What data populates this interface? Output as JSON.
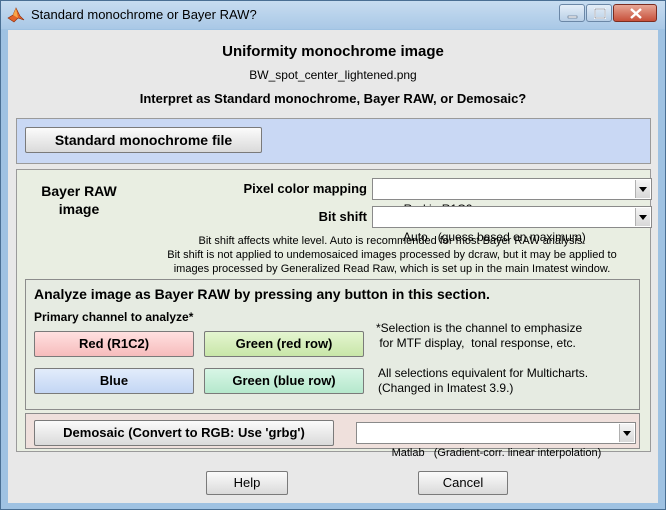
{
  "window": {
    "title": "Standard monochrome or Bayer RAW?",
    "controls": [
      "minimize",
      "maximize",
      "close"
    ]
  },
  "header": {
    "title": "Uniformity monochrome image",
    "filename": "BW_spot_center_lightened.png",
    "question": "Interpret as Standard monochrome, Bayer RAW, or Demosaic?"
  },
  "standard": {
    "button_label": "Standard monochrome file"
  },
  "bayer": {
    "label": "Bayer RAW image",
    "pixel_mapping": {
      "label": "Pixel color mapping",
      "value": "Red in R1C2"
    },
    "bit_shift": {
      "label": "Bit shift",
      "value": "Auto   (guess based on maximum)"
    },
    "note": [
      "Bit shift affects white level. Auto is recommended for most Bayer RAW analysis.",
      "Bit shift is not applied to undemosaiced images processed by dcraw, but it may be applied to",
      "images processed by Generalized Read Raw, which is set up in the main Imatest window."
    ],
    "analyze": {
      "title": "Analyze image as Bayer RAW by pressing any button in this section.",
      "primary_label": "Primary channel to analyze*",
      "buttons": {
        "red": "Red  (R1C2)",
        "green_red_row": "Green (red row)",
        "blue": "Blue",
        "green_blue_row": "Green (blue row)"
      },
      "selection_note": [
        "*Selection is the channel to emphasize",
        " for MTF display,  tonal response, etc."
      ],
      "multicharts_note": [
        "All selections equivalent for Multicharts.",
        "(Changed in Imatest 3.9.)"
      ]
    },
    "demosaic": {
      "button_label": "Demosaic  (Convert to RGB:  Use 'grbg')",
      "method_value": "Matlab   (Gradient-corr. linear interpolation)"
    }
  },
  "footer": {
    "help_label": "Help",
    "cancel_label": "Cancel"
  },
  "colors": {
    "frame": "#9fc2e2",
    "client_bg": "#e8e8e8",
    "standard_panel": "#c9d8f4",
    "bayer_panel": "#e9eee2",
    "demosaic_panel": "#efe0dc",
    "red_button": "#f6bcbc",
    "green_button": "#c8e6a8",
    "blue_button": "#c3d6f4",
    "teal_button": "#b5e8cc"
  }
}
